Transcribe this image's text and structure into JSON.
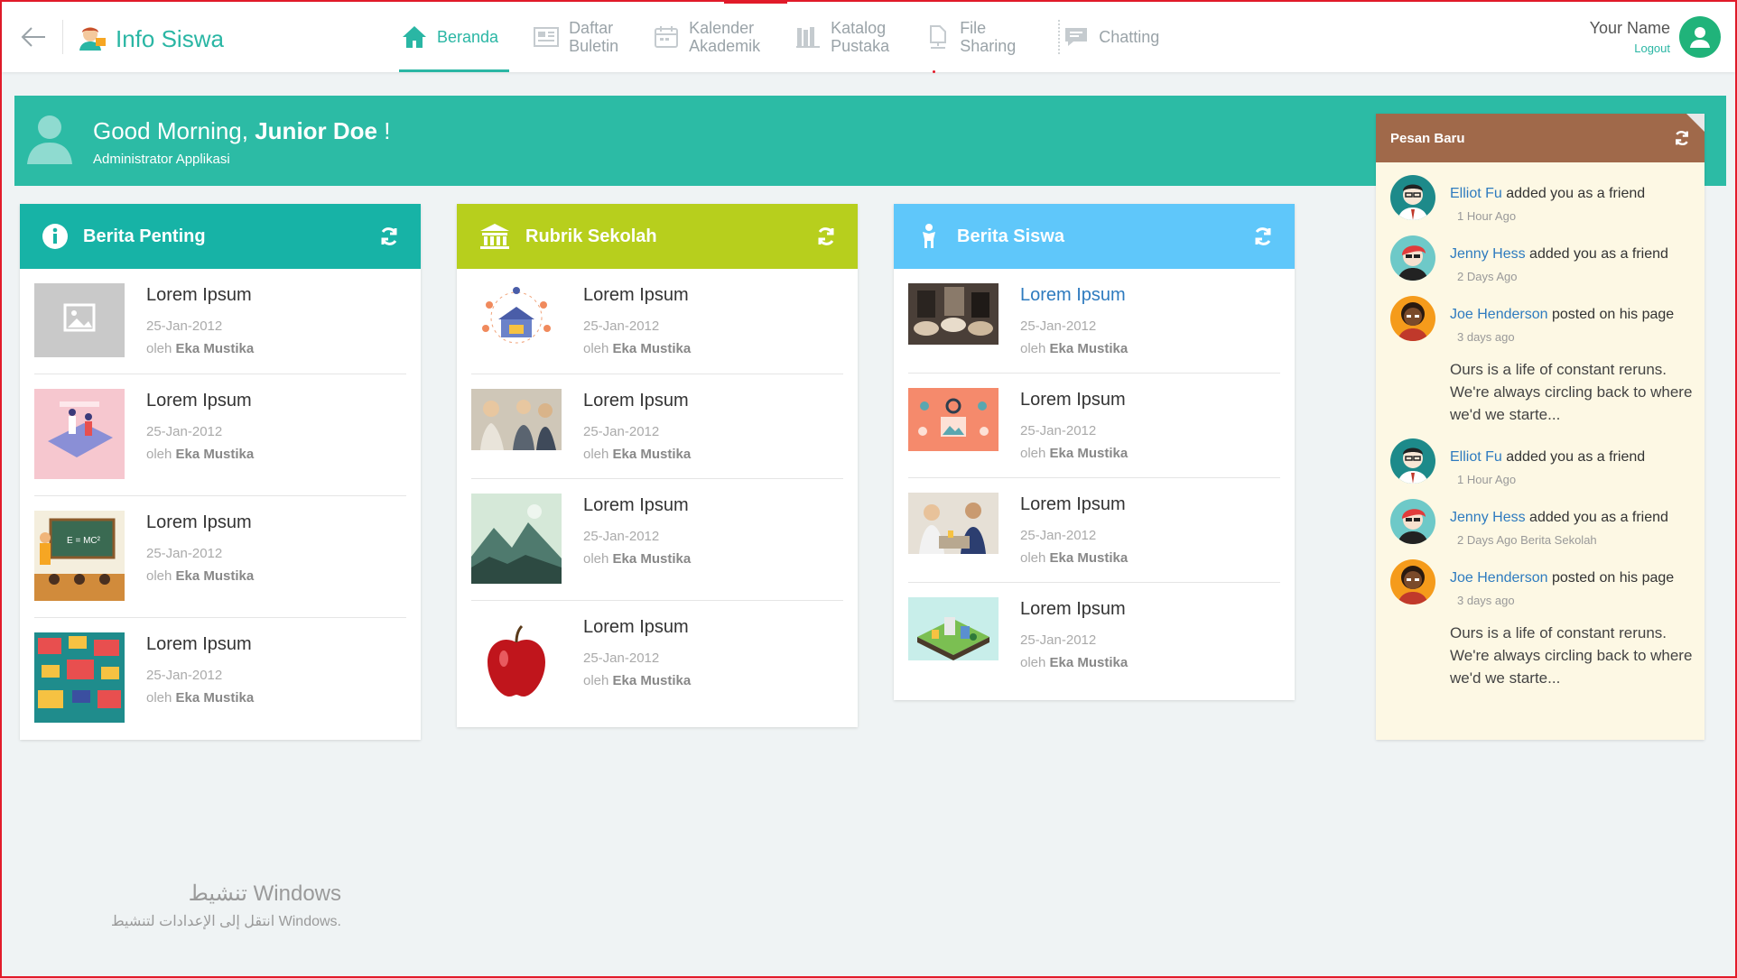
{
  "app": {
    "title": "Info Siswa"
  },
  "nav": [
    {
      "label": "Beranda",
      "icon": "home-icon",
      "active": true
    },
    {
      "label": "Daftar Buletin",
      "line1": "Daftar",
      "line2": "Buletin",
      "icon": "newspaper-icon"
    },
    {
      "label": "Kalender Akademik",
      "line1": "Kalender",
      "line2": "Akademik",
      "icon": "calendar-icon"
    },
    {
      "label": "Katalog Pustaka",
      "line1": "Katalog",
      "line2": "Pustaka",
      "icon": "books-icon"
    },
    {
      "label": "File Sharing",
      "line1": "File",
      "line2": "Sharing",
      "icon": "file-sharing-icon"
    },
    {
      "label": "Chatting",
      "icon": "chat-icon"
    }
  ],
  "user": {
    "name": "Your Name",
    "logout": "Logout"
  },
  "greeting": {
    "prefix": "Good Morning, ",
    "name": "Junior Doe",
    "suffix": " !",
    "role": "Administrator Applikasi"
  },
  "cards": [
    {
      "title": "Berita Penting",
      "color": "#17b3a6",
      "icon": "info-icon",
      "items": [
        {
          "title": "Lorem Ipsum",
          "date": "25-Jan-2012",
          "by_prefix": "oleh ",
          "author": "Eka Mustika",
          "thumb": "placeholder-image"
        },
        {
          "title": "Lorem Ipsum",
          "date": "25-Jan-2012",
          "by_prefix": "oleh ",
          "author": "Eka Mustika",
          "thumb": "tablet-illustration"
        },
        {
          "title": "Lorem Ipsum",
          "date": "25-Jan-2012",
          "by_prefix": "oleh ",
          "author": "Eka Mustika",
          "thumb": "classroom-illustration"
        },
        {
          "title": "Lorem Ipsum",
          "date": "25-Jan-2012",
          "by_prefix": "oleh ",
          "author": "Eka Mustika",
          "thumb": "screens-pattern"
        }
      ]
    },
    {
      "title": "Rubrik Sekolah",
      "color": "#b7cf1d",
      "icon": "building-icon",
      "items": [
        {
          "title": "Lorem Ipsum",
          "date": "25-Jan-2012",
          "by_prefix": "oleh ",
          "author": "Eka Mustika",
          "thumb": "school-network"
        },
        {
          "title": "Lorem Ipsum",
          "date": "25-Jan-2012",
          "by_prefix": "oleh ",
          "author": "Eka Mustika",
          "thumb": "students-photo"
        },
        {
          "title": "Lorem Ipsum",
          "date": "25-Jan-2012",
          "by_prefix": "oleh ",
          "author": "Eka Mustika",
          "thumb": "mountain-landscape"
        },
        {
          "title": "Lorem Ipsum",
          "date": "25-Jan-2012",
          "by_prefix": "oleh ",
          "author": "Eka Mustika",
          "thumb": "red-apple"
        }
      ]
    },
    {
      "title": "Berita Siswa",
      "color": "#5fc7fa",
      "icon": "student-icon",
      "items": [
        {
          "title": "Lorem Ipsum",
          "date": "25-Jan-2012",
          "by_prefix": "oleh ",
          "author": "Eka Mustika",
          "thumb": "students-group",
          "link": true
        },
        {
          "title": "Lorem Ipsum",
          "date": "25-Jan-2012",
          "by_prefix": "oleh ",
          "author": "Eka Mustika",
          "thumb": "gears-illustration"
        },
        {
          "title": "Lorem Ipsum",
          "date": "25-Jan-2012",
          "by_prefix": "oleh ",
          "author": "Eka Mustika",
          "thumb": "kids-lab"
        },
        {
          "title": "Lorem Ipsum",
          "date": "25-Jan-2012",
          "by_prefix": "oleh ",
          "author": "Eka Mustika",
          "thumb": "isometric-city"
        }
      ]
    }
  ],
  "messages": {
    "title": "Pesan Baru",
    "items": [
      {
        "name": "Elliot Fu",
        "action": " added you as a friend",
        "time": "1 Hour Ago",
        "avatar": "teal"
      },
      {
        "name": "Jenny Hess",
        "action": " added you as a friend",
        "time": "2 Days Ago",
        "avatar": "aqua"
      },
      {
        "name": "Joe Henderson",
        "action": " posted on his page",
        "time": "3 days ago",
        "avatar": "orange",
        "body": "Ours is a life of constant reruns. We're always circling back to where we'd we starte..."
      },
      {
        "name": "Elliot Fu",
        "action": " added you as a friend",
        "time": "1 Hour Ago",
        "avatar": "teal"
      },
      {
        "name": "Jenny Hess",
        "action": " added you as a friend",
        "time": "2 Days Ago Berita Sekolah",
        "avatar": "aqua"
      },
      {
        "name": "Joe Henderson",
        "action": " posted on his page",
        "time": "3 days ago",
        "avatar": "orange",
        "body": "Ours is a life of constant reruns. We're always circling back to where we'd we starte..."
      }
    ]
  },
  "watermark": {
    "line1": "تنشيط Windows",
    "line2": "انتقل إلى الإعدادات لتنشيط Windows."
  },
  "colors": {
    "accent": "#2ab6a4",
    "greeting_bg": "#2cbba5",
    "messages_header": "#a0694a",
    "messages_bg": "#fdf8e4",
    "link": "#2e7bbf"
  }
}
